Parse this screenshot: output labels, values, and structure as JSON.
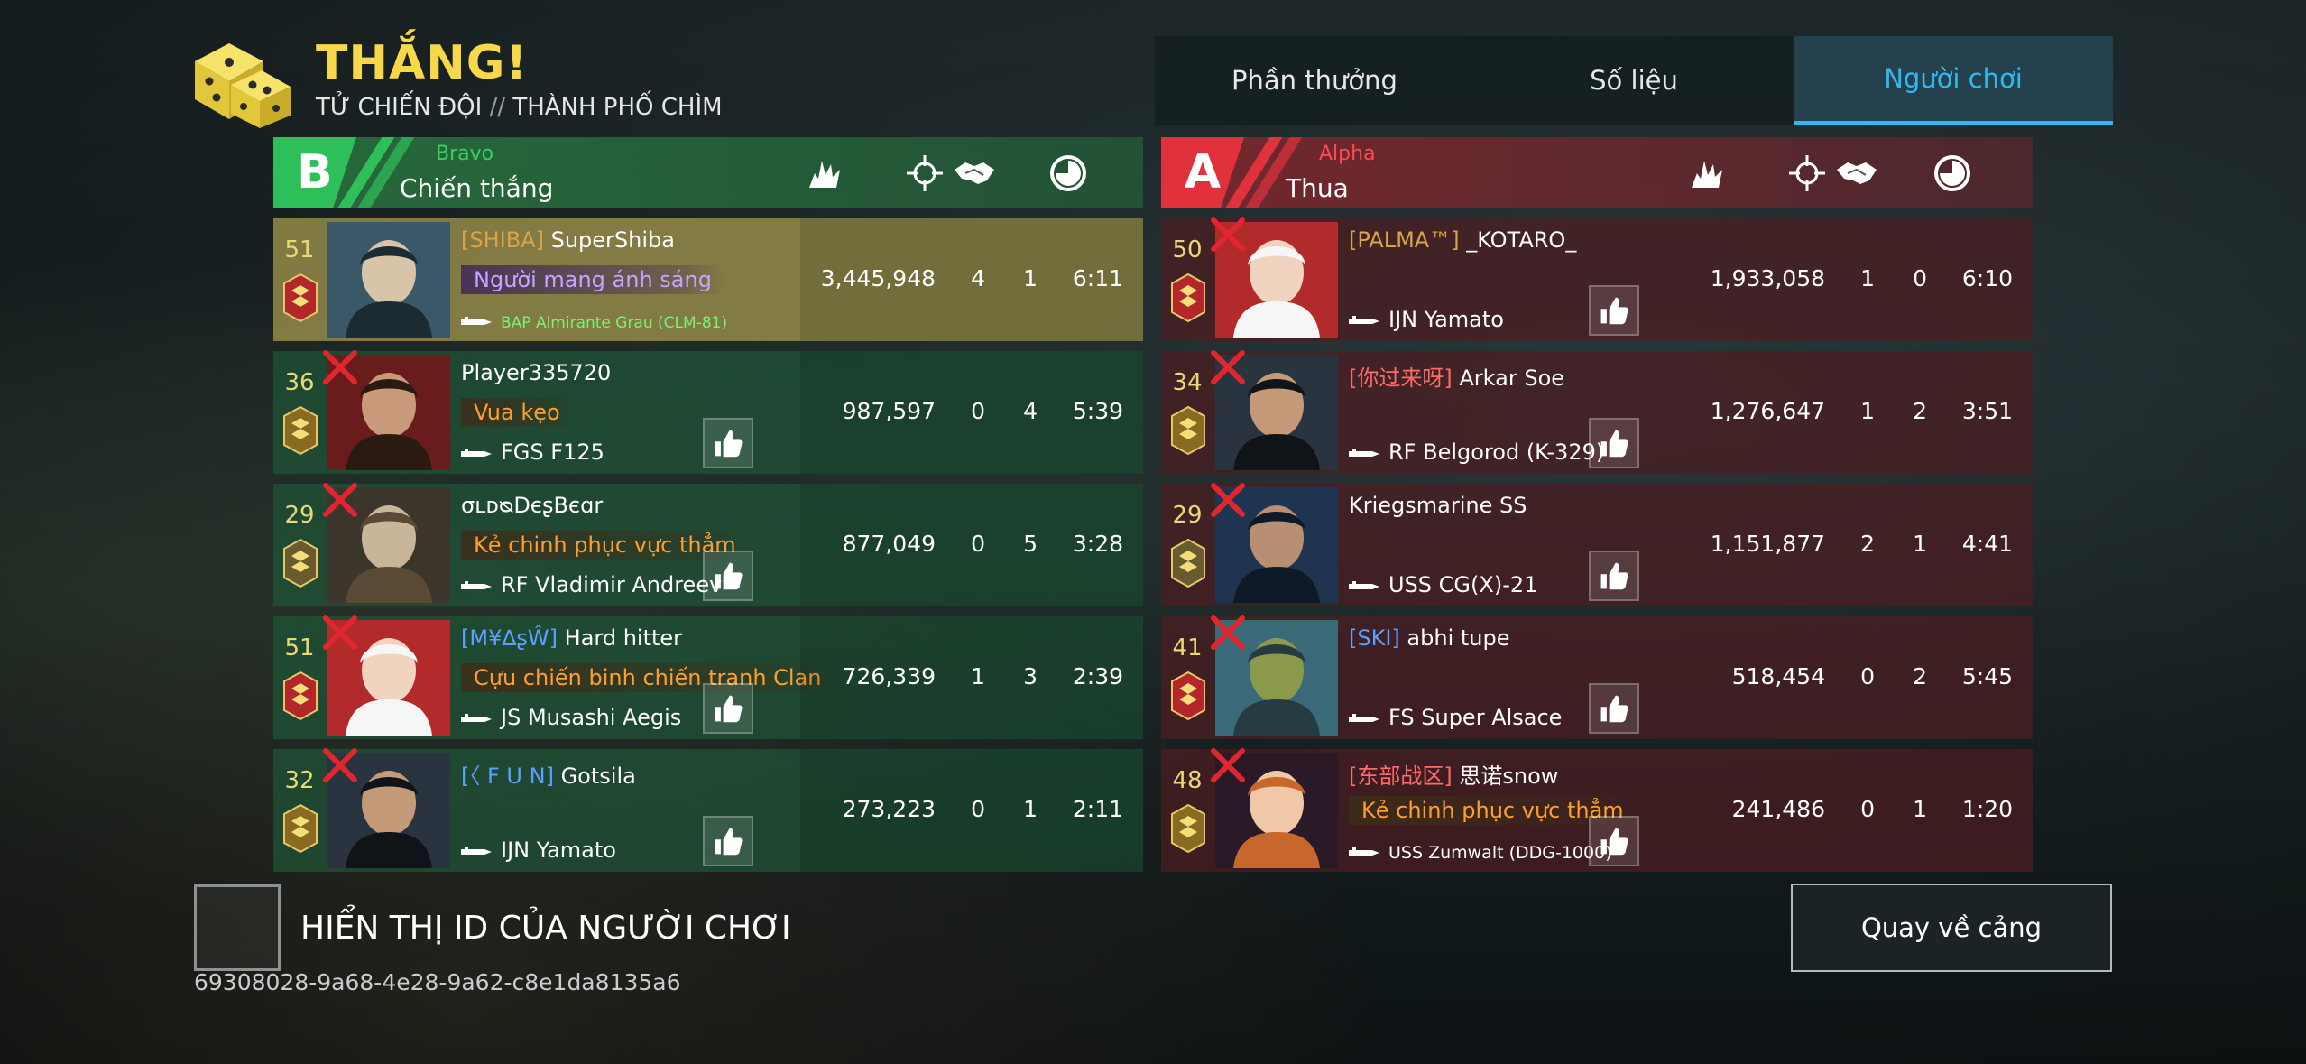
{
  "header": {
    "result": "THẮNG!",
    "mode": "TỬ CHIẾN ĐỘI",
    "separator": "//",
    "map": "THÀNH PHỐ CHÌM"
  },
  "tabs": [
    {
      "label": "Phần thưởng",
      "active": false
    },
    {
      "label": "Số liệu",
      "active": false
    },
    {
      "label": "Người chơi",
      "active": true
    }
  ],
  "teams": {
    "left": {
      "letter": "B",
      "name": "Bravo",
      "result": "Chiến thắng",
      "color": "#2fbf5a",
      "players": [
        {
          "rank": "51",
          "clan": "[SHIBA]",
          "name": "SuperShiba",
          "title": "Người mang ánh sáng",
          "ship": "BAP Almirante Grau (CLM-81)",
          "score": "3,445,948",
          "kills": "4",
          "assists": "1",
          "time": "6:11",
          "me": true,
          "dead": false
        },
        {
          "rank": "36",
          "clan": "",
          "name": "Player335720",
          "title": "Vua kẹo",
          "ship": "FGS F125",
          "score": "987,597",
          "kills": "0",
          "assists": "4",
          "time": "5:39",
          "dead": true
        },
        {
          "rank": "29",
          "clan": "",
          "name": "σʟᴅᴓDєʂBєɑr",
          "title": "Kẻ chinh phục vực thẳm",
          "ship": "RF Vladimir Andreev",
          "score": "877,049",
          "kills": "0",
          "assists": "5",
          "time": "3:28",
          "dead": true
        },
        {
          "rank": "51",
          "clan": "[M¥∆ʂŴ]",
          "name": "Hard hitter",
          "title": "Cựu chiến binh chiến tranh Clan",
          "ship": "JS Musashi Aegis",
          "score": "726,339",
          "kills": "1",
          "assists": "3",
          "time": "2:39",
          "dead": true
        },
        {
          "rank": "32",
          "clan": "[〈 F U N]",
          "name": "Gotsila",
          "title": "",
          "ship": "IJN Yamato",
          "score": "273,223",
          "kills": "0",
          "assists": "1",
          "time": "2:11",
          "dead": true
        }
      ]
    },
    "right": {
      "letter": "A",
      "name": "Alpha",
      "result": "Thua",
      "color": "#e0313c",
      "players": [
        {
          "rank": "50",
          "clan": "[PALMA™]",
          "name": "_KOTARO_",
          "title": "",
          "ship": "IJN Yamato",
          "score": "1,933,058",
          "kills": "1",
          "assists": "0",
          "time": "6:10",
          "dead": true
        },
        {
          "rank": "34",
          "clan": "[你过来呀]",
          "name": "Arkar Soe",
          "title": "",
          "ship": "RF Belgorod (K-329)",
          "score": "1,276,647",
          "kills": "1",
          "assists": "2",
          "time": "3:51",
          "dead": true
        },
        {
          "rank": "29",
          "clan": "",
          "name": "Kriegsmarine SS",
          "title": "",
          "ship": "USS CG(X)-21",
          "score": "1,151,877",
          "kills": "2",
          "assists": "1",
          "time": "4:41",
          "dead": true
        },
        {
          "rank": "41",
          "clan": "[SKI]",
          "name": "abhi tupe",
          "title": "",
          "ship": "FS Super Alsace",
          "score": "518,454",
          "kills": "0",
          "assists": "2",
          "time": "5:45",
          "dead": true
        },
        {
          "rank": "48",
          "clan": "[东部战区]",
          "name": "思诺snow",
          "title": "Kẻ chinh phục vực thẳm",
          "ship": "USS Zumwalt (DDG-1000)",
          "score": "241,486",
          "kills": "0",
          "assists": "1",
          "time": "1:20",
          "dead": true
        }
      ]
    }
  },
  "column_icons": [
    "score-icon",
    "kills-crosshair-icon",
    "assists-handshake-icon",
    "time-clock-icon"
  ],
  "footer": {
    "show_id_label": "HIỂN THỊ ID CỦA NGƯỜI CHƠI",
    "player_id": "69308028-9a68-4e28-9a62-c8e1da8135a6",
    "back_button": "Quay về cảng"
  }
}
